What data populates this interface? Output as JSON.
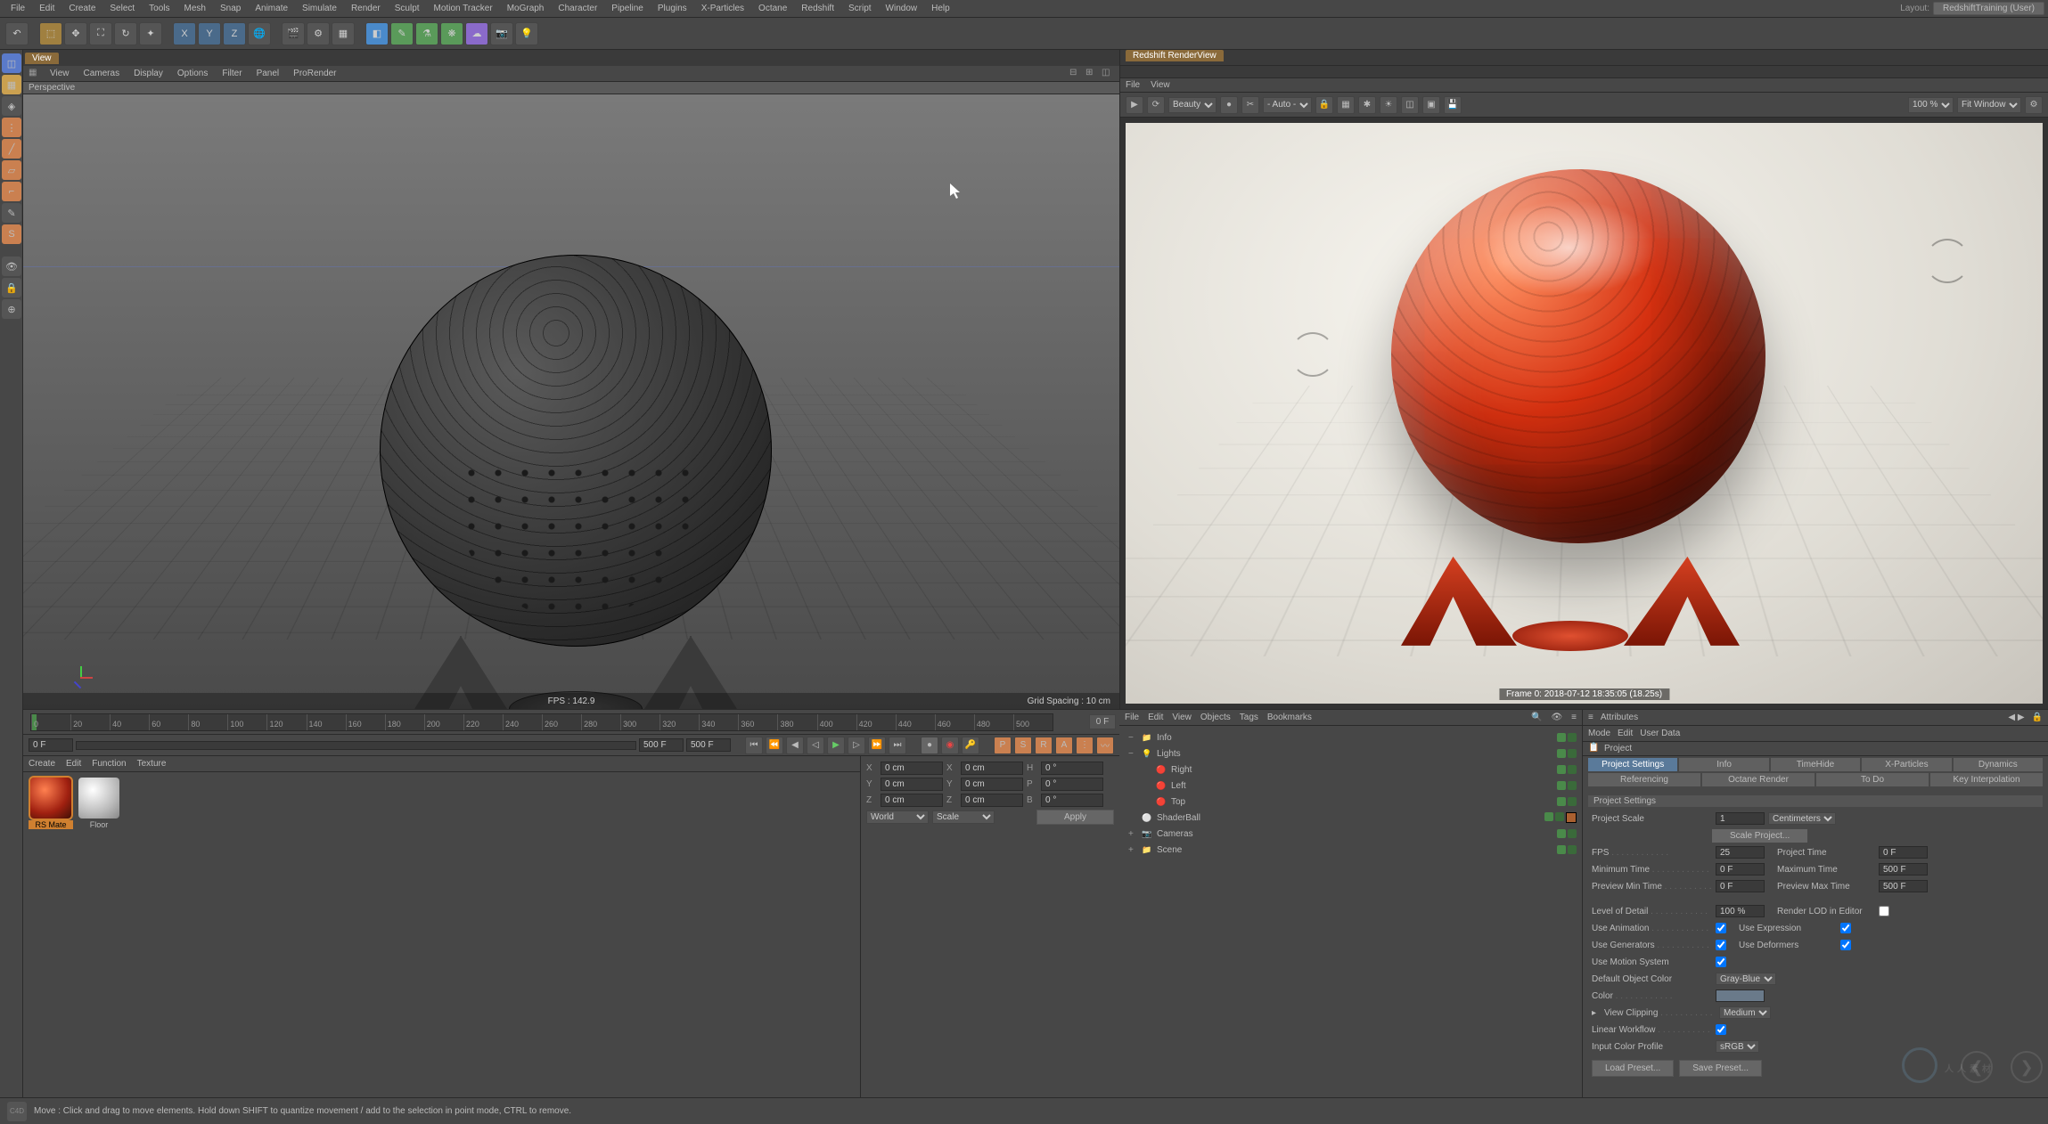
{
  "layout": {
    "label": "Layout:",
    "value": "RedshiftTraining (User)"
  },
  "menubar": [
    "File",
    "Edit",
    "Create",
    "Select",
    "Tools",
    "Mesh",
    "Snap",
    "Animate",
    "Simulate",
    "Render",
    "Sculpt",
    "Motion Tracker",
    "MoGraph",
    "Character",
    "Pipeline",
    "Plugins",
    "X-Particles",
    "Octane",
    "Redshift",
    "Script",
    "Window",
    "Help"
  ],
  "viewport": {
    "tab": "View",
    "menus": [
      "View",
      "Cameras",
      "Display",
      "Options",
      "Filter",
      "Panel",
      "ProRender"
    ],
    "label": "Perspective",
    "fps": "FPS : 142.9",
    "grid": "Grid Spacing : 10 cm"
  },
  "renderview": {
    "title": "Redshift RenderView",
    "menus": [
      "File",
      "View"
    ],
    "channel": "Beauty",
    "auto": "- Auto -",
    "zoom": "100 %",
    "fit": "Fit Window",
    "caption": "Frame  0:   2018-07-12   18:35:05   (18.25s)"
  },
  "timeline": {
    "ticks": [
      "0",
      "20",
      "40",
      "60",
      "80",
      "100",
      "120",
      "140",
      "160",
      "180",
      "200",
      "220",
      "240",
      "260",
      "280",
      "300",
      "320",
      "340",
      "360",
      "380",
      "400",
      "420",
      "440",
      "460",
      "480",
      "500"
    ],
    "end": "0 F",
    "startFrame": "0 F",
    "endA": "500 F",
    "endB": "500 F"
  },
  "materials": {
    "menus": [
      "Create",
      "Edit",
      "Function",
      "Texture"
    ],
    "items": [
      {
        "name": "RS Mate",
        "sel": true
      },
      {
        "name": "Floor",
        "sel": false
      }
    ]
  },
  "coords": {
    "rows": [
      {
        "a": "X",
        "av": "0 cm",
        "b": "X",
        "bv": "0 cm",
        "c": "H",
        "cv": "0 °"
      },
      {
        "a": "Y",
        "av": "0 cm",
        "b": "Y",
        "bv": "0 cm",
        "c": "P",
        "cv": "0 °"
      },
      {
        "a": "Z",
        "av": "0 cm",
        "b": "Z",
        "bv": "0 cm",
        "c": "B",
        "cv": "0 °"
      }
    ],
    "world": "World",
    "scale": "Scale",
    "apply": "Apply"
  },
  "objects": {
    "menus": [
      "File",
      "Edit",
      "View",
      "Objects",
      "Tags",
      "Bookmarks"
    ],
    "tree": [
      {
        "ind": 0,
        "exp": "−",
        "ico": "📁",
        "name": "Info"
      },
      {
        "ind": 0,
        "exp": "−",
        "ico": "💡",
        "name": "Lights"
      },
      {
        "ind": 1,
        "exp": "",
        "ico": "🔴",
        "name": "Right"
      },
      {
        "ind": 1,
        "exp": "",
        "ico": "🔴",
        "name": "Left"
      },
      {
        "ind": 1,
        "exp": "",
        "ico": "🔴",
        "name": "Top"
      },
      {
        "ind": 0,
        "exp": "",
        "ico": "⚪",
        "name": "ShaderBall",
        "tag": true
      },
      {
        "ind": 0,
        "exp": "+",
        "ico": "📷",
        "name": "Cameras"
      },
      {
        "ind": 0,
        "exp": "+",
        "ico": "📁",
        "name": "Scene"
      }
    ]
  },
  "attributes": {
    "title": "Attributes",
    "menus": [
      "Mode",
      "Edit",
      "User Data"
    ],
    "crumb": "Project",
    "tabs": [
      "Project Settings",
      "Info",
      "TimeHide",
      "X-Particles",
      "Dynamics",
      "Referencing",
      "Octane Render",
      "To Do",
      "Key Interpolation"
    ],
    "section": "Project Settings",
    "projectScale": {
      "lbl": "Project Scale",
      "val": "1",
      "unit": "Centimeters"
    },
    "scaleProject": "Scale Project...",
    "fps": {
      "lbl": "FPS",
      "val": "25"
    },
    "projectTime": {
      "lbl": "Project Time",
      "val": "0 F"
    },
    "minTime": {
      "lbl": "Minimum Time",
      "val": "0 F"
    },
    "maxTime": {
      "lbl": "Maximum Time",
      "val": "500 F"
    },
    "prevMin": {
      "lbl": "Preview Min Time",
      "val": "0 F"
    },
    "prevMax": {
      "lbl": "Preview Max Time",
      "val": "500 F"
    },
    "lod": {
      "lbl": "Level of Detail",
      "val": "100 %"
    },
    "renderLOD": "Render LOD in Editor",
    "useAnim": "Use Animation",
    "useExpr": "Use Expression",
    "useGen": "Use Generators",
    "useDef": "Use Deformers",
    "useMotion": "Use Motion System",
    "defColor": {
      "lbl": "Default Object Color",
      "val": "Gray-Blue"
    },
    "color": "Color",
    "viewClip": {
      "lbl": "View Clipping",
      "val": "Medium"
    },
    "linearWF": "Linear Workflow",
    "inputProfile": {
      "lbl": "Input Color Profile",
      "val": "sRGB"
    },
    "load": "Load Preset...",
    "save": "Save Preset..."
  },
  "status": "Move : Click and drag to move elements. Hold down SHIFT to quantize movement / add to the selection in point mode, CTRL to remove.",
  "watermark": "人人素材"
}
